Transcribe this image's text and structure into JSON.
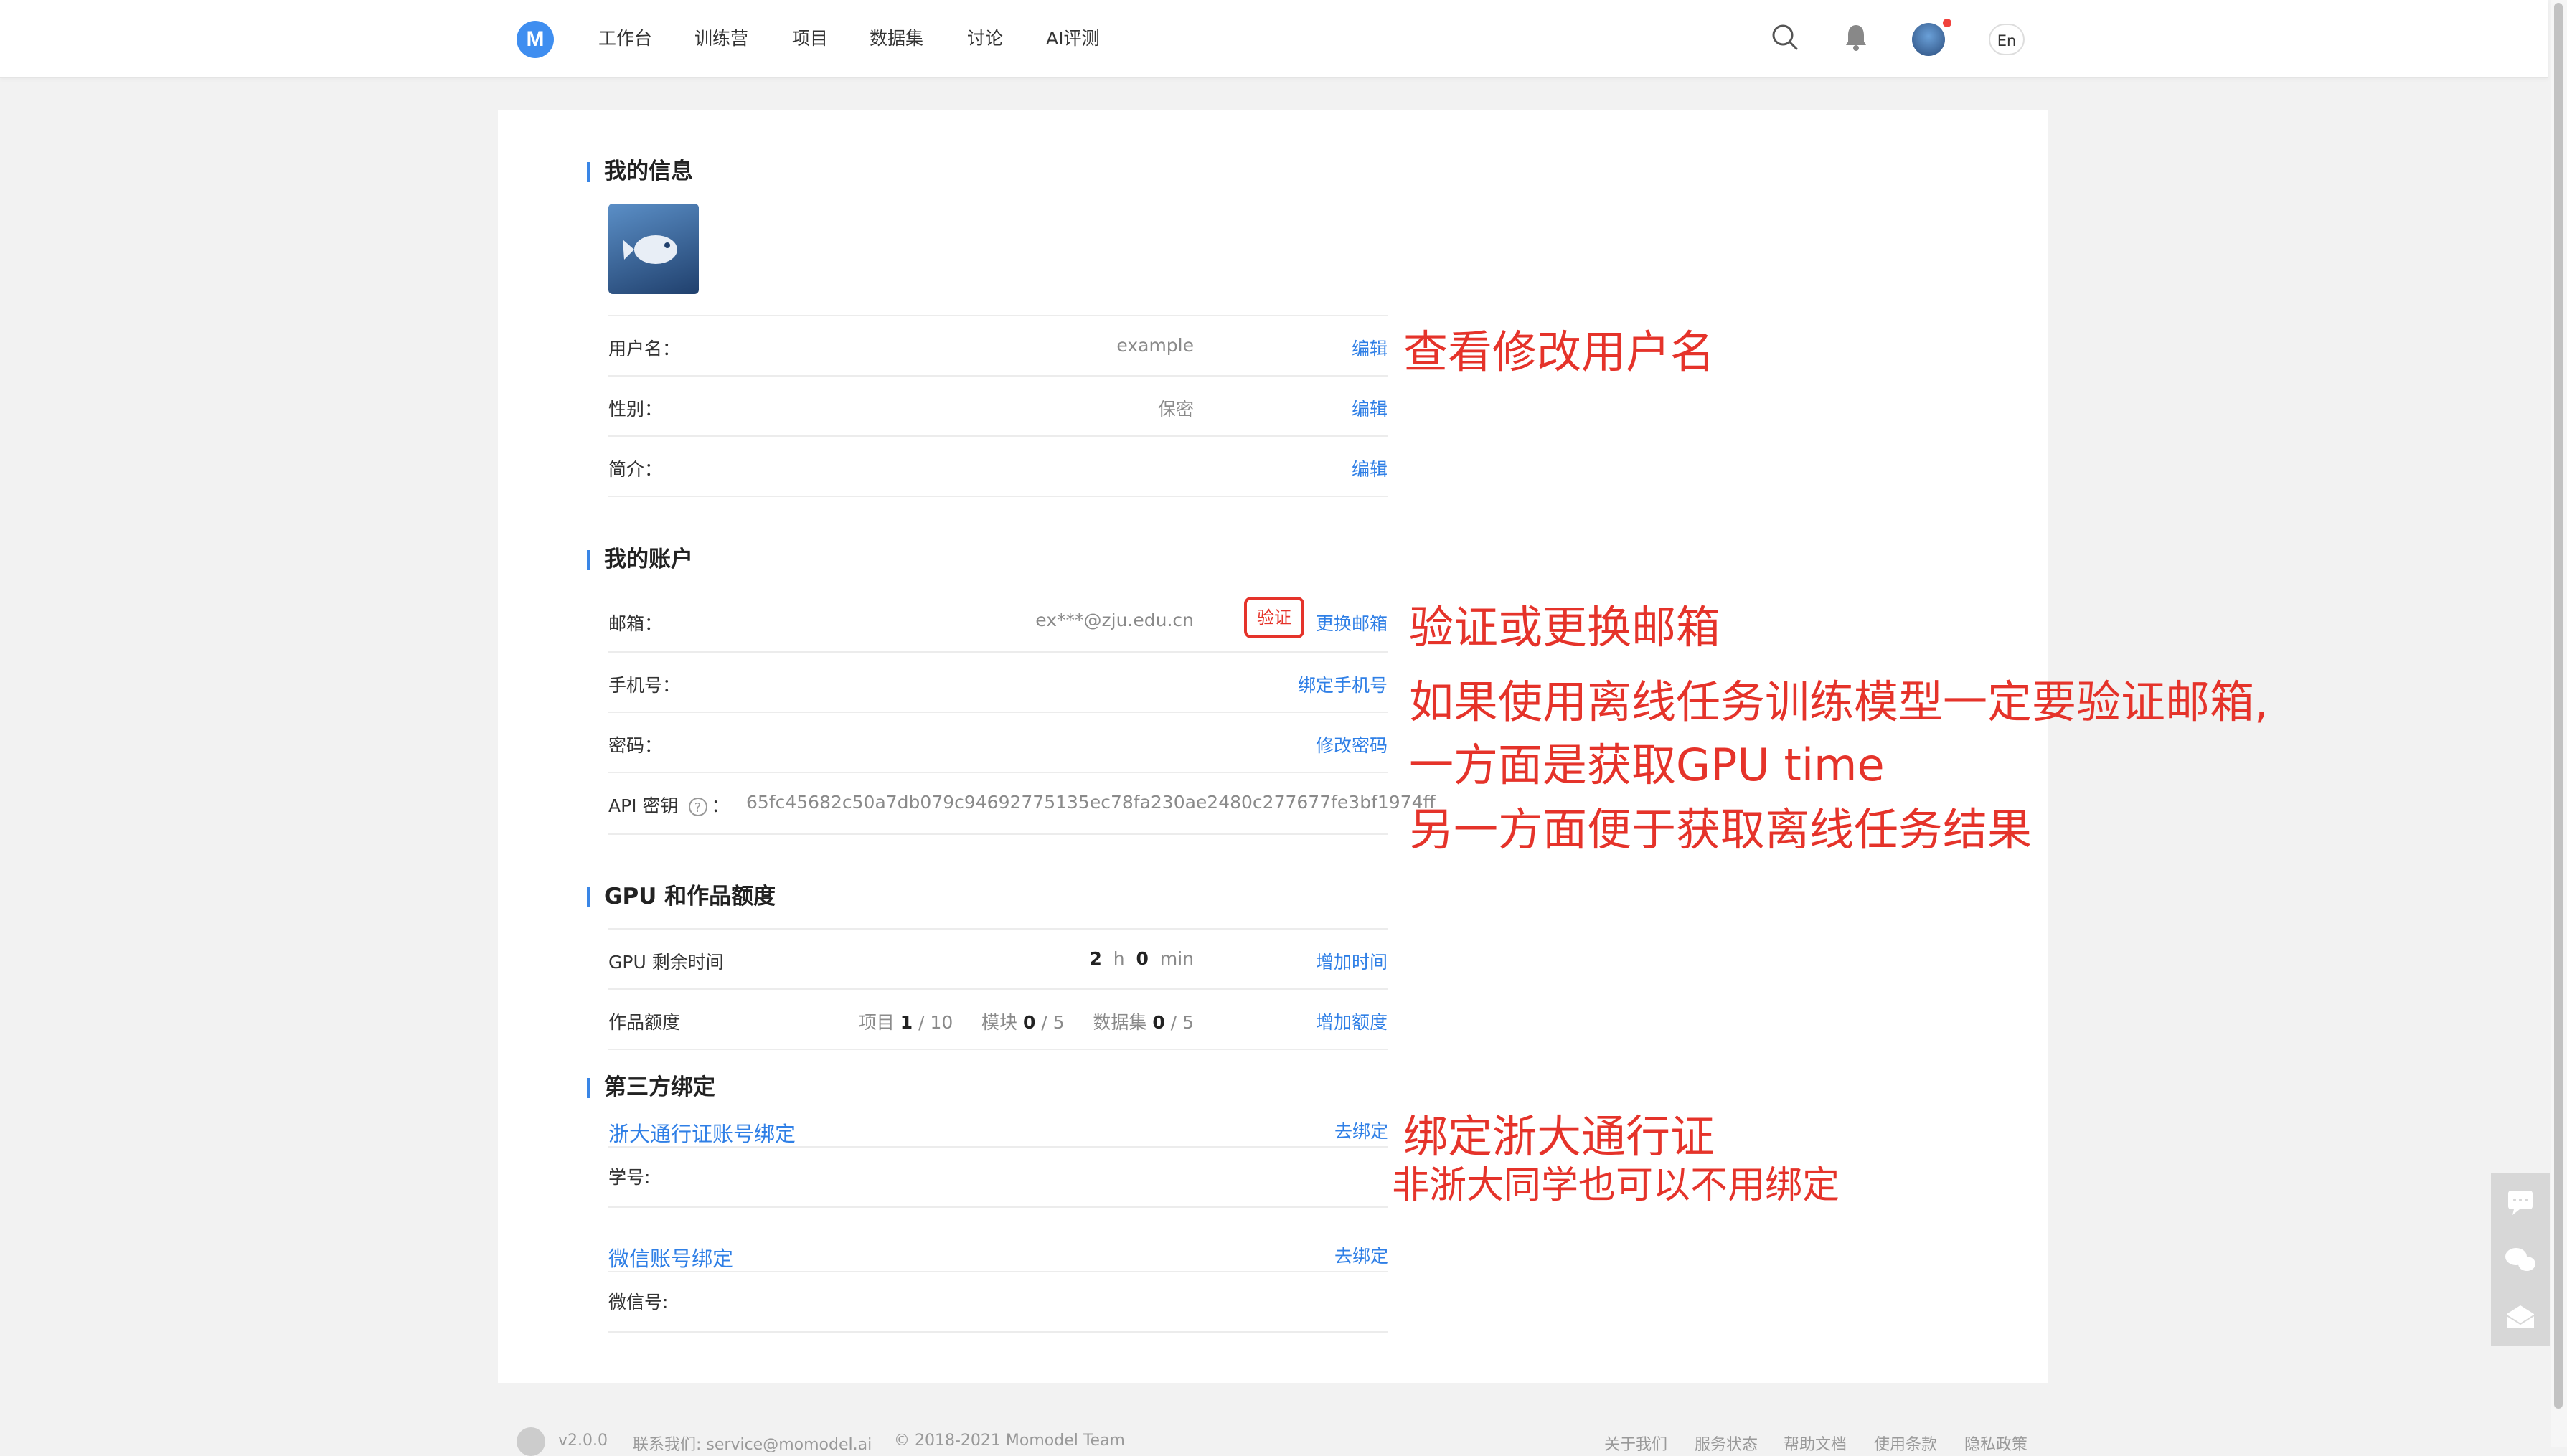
{
  "nav": {
    "logo": "M",
    "items": [
      "工作台",
      "训练营",
      "项目",
      "数据集",
      "讨论",
      "AI评测"
    ],
    "lang": "En"
  },
  "my_info": {
    "title": "我的信息",
    "rows": [
      {
        "label": "用户名：",
        "value": "example",
        "action": "编辑"
      },
      {
        "label": "性别：",
        "value": "保密",
        "action": "编辑"
      },
      {
        "label": "简介：",
        "value": "",
        "action": "编辑"
      }
    ]
  },
  "my_account": {
    "title": "我的账户",
    "email": {
      "label": "邮箱：",
      "value": "ex***@zju.edu.cn",
      "verify": "验证",
      "action": "更换邮箱"
    },
    "phone": {
      "label": "手机号：",
      "action": "绑定手机号"
    },
    "password": {
      "label": "密码：",
      "action": "修改密码"
    },
    "api": {
      "label": "API 密钥",
      "help": "?",
      "colon": "：",
      "value": "65fc45682c50a7db079c94692775135ec78fa230ae2480c277677fe3bf1974ff"
    }
  },
  "quota": {
    "title": "GPU 和作品额度",
    "gpu": {
      "label": "GPU 剩余时间",
      "hours": "2",
      "h_unit": "h",
      "minutes": "0",
      "min_unit": "min",
      "action": "增加时间"
    },
    "works": {
      "label": "作品额度",
      "project_label": "项目",
      "project_used": "1",
      "project_total": "/ 10",
      "module_label": "模块",
      "module_used": "0",
      "module_total": "/ 5",
      "dataset_label": "数据集",
      "dataset_used": "0",
      "dataset_total": "/ 5",
      "action": "增加额度"
    }
  },
  "third_party": {
    "title": "第三方绑定",
    "zju": {
      "title": "浙大通行证账号绑定",
      "action": "去绑定",
      "field": "学号:"
    },
    "wechat": {
      "title": "微信账号绑定",
      "action": "去绑定",
      "field": "微信号:"
    }
  },
  "annotations": {
    "username": "查看修改用户名",
    "email": "验证或更换邮箱",
    "offline_1": "如果使用离线任务训练模型一定要验证邮箱,",
    "offline_2": "一方面是获取GPU time",
    "offline_3": "另一方面便于获取离线任务结果",
    "zju_1": "绑定浙大通行证",
    "zju_2": "非浙大同学也可以不用绑定"
  },
  "footer": {
    "version": "v2.0.0",
    "contact": "联系我们: service@momodel.ai",
    "copyright": "© 2018-2021 Momodel Team",
    "links": [
      "关于我们",
      "服务状态",
      "帮助文档",
      "使用条款",
      "隐私政策"
    ]
  },
  "colors": {
    "accent": "#2f7fe6",
    "annotation": "#e5332a",
    "section_bar": "#3a86e6"
  }
}
